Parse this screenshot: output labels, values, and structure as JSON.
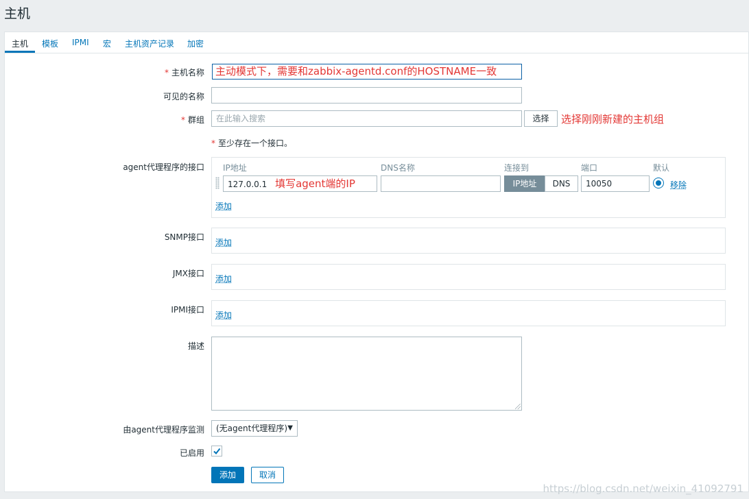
{
  "page": {
    "title": "主机"
  },
  "tabs": [
    "主机",
    "模板",
    "IPMI",
    "宏",
    "主机资产记录",
    "加密"
  ],
  "form": {
    "host_name": {
      "label": "主机名称",
      "required_mark": "*",
      "value": "主动模式下，需要和zabbix-agentd.conf的HOSTNAME一致"
    },
    "visible_name": {
      "label": "可见的名称",
      "value": ""
    },
    "groups": {
      "label": "群组",
      "required_mark": "*",
      "placeholder": "在此输入搜索",
      "select_button": "选择",
      "annotation": "选择刚刚新建的主机组"
    },
    "interface_note": {
      "mark": "*",
      "text": "至少存在一个接口。"
    },
    "agent_interfaces": {
      "label": "agent代理程序的接口",
      "headers": {
        "ip": "IP地址",
        "dns": "DNS名称",
        "connect": "连接到",
        "port": "端口",
        "default": "默认"
      },
      "row": {
        "ip": "127.0.0.1",
        "ip_annotation": "填写agent端的IP",
        "dns": "",
        "connect_ip": "IP地址",
        "connect_dns": "DNS",
        "port": "10050",
        "remove": "移除"
      },
      "add": "添加"
    },
    "snmp_interfaces": {
      "label": "SNMP接口",
      "add": "添加"
    },
    "jmx_interfaces": {
      "label": "JMX接口",
      "add": "添加"
    },
    "ipmi_interfaces": {
      "label": "IPMI接口",
      "add": "添加"
    },
    "description": {
      "label": "描述",
      "value": ""
    },
    "proxy": {
      "label": "由agent代理程序监测",
      "selected": "(无agent代理程序)"
    },
    "enabled": {
      "label": "已启用",
      "checked": true
    },
    "buttons": {
      "add": "添加",
      "cancel": "取消"
    }
  },
  "watermark": "https://blog.csdn.net/weixin_41092791",
  "colors": {
    "accent": "#0275b8",
    "annotation": "#e33734",
    "background": "#ebeef0"
  }
}
